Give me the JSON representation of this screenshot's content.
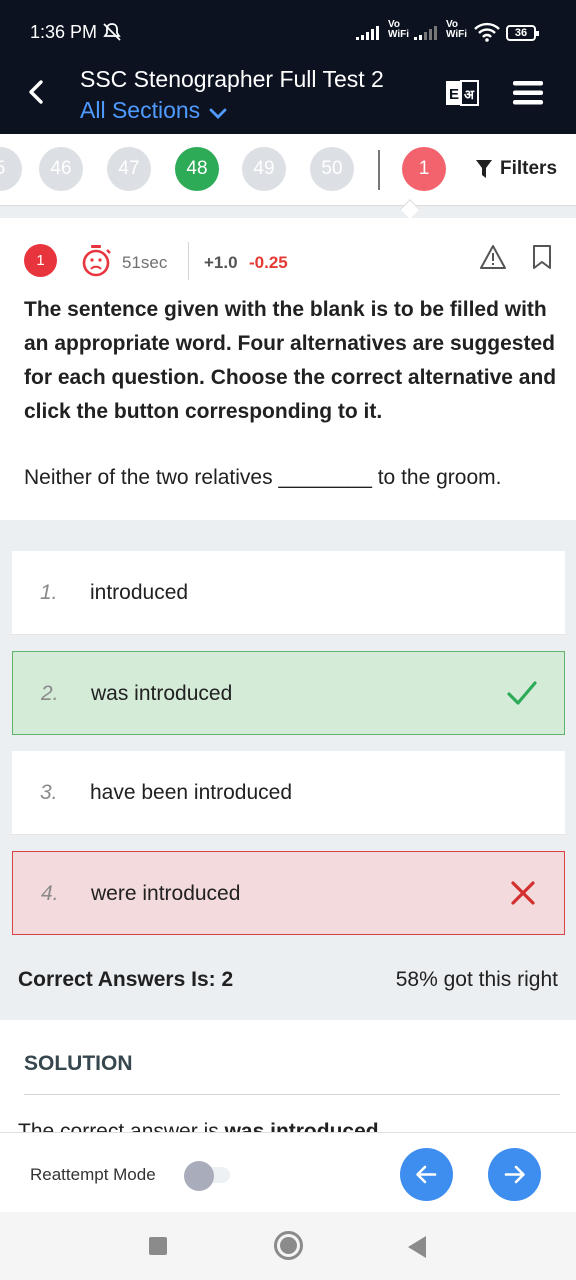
{
  "status_bar": {
    "time": "1:36 PM",
    "mute_icon": "bell-off-icon",
    "vo_wifi_label_1": "Vo\nWiFi",
    "vo_wifi_label_2": "Vo\nWiFi",
    "battery": "36"
  },
  "header": {
    "title": "SSC Stenographer Full Test 2",
    "sections_label": "All Sections",
    "back_icon": "chevron-left-icon",
    "language_icon": "language-toggle-icon",
    "menu_icon": "hamburger-menu-icon"
  },
  "question_nav": {
    "bubbles": [
      "5",
      "46",
      "47",
      "48",
      "49",
      "50"
    ],
    "current": "48",
    "flag_bubble": "1",
    "filters_label": "Filters"
  },
  "question": {
    "number": "1",
    "time_taken": "51sec",
    "positive_marks": "+1.0",
    "negative_marks": "-0.25",
    "instruction": "The sentence given with the blank is to be filled with an appropriate word. Four alternatives are suggested for each question. Choose the correct alternative and click the button corresponding to it.",
    "sentence": "Neither of the two relatives ________ to the groom."
  },
  "options": [
    {
      "num": "1.",
      "text": "introduced",
      "state": "neutral"
    },
    {
      "num": "2.",
      "text": "was introduced",
      "state": "correct"
    },
    {
      "num": "3.",
      "text": "have been introduced",
      "state": "neutral"
    },
    {
      "num": "4.",
      "text": "were introduced",
      "state": "wrong"
    }
  ],
  "result": {
    "correct_answer": "Correct Answers Is: 2",
    "stats": "58% got this right"
  },
  "solution": {
    "heading": "SOLUTION",
    "preview": "The correct answer is was introduced"
  },
  "bottom": {
    "reattempt_label": "Reattempt Mode",
    "reattempt_on": false
  },
  "colors": {
    "header_bg": "#0c1220",
    "accent_blue": "#4f9bff",
    "current_bubble": "#2eab57",
    "flag_bubble": "#f3636e",
    "correct_bg": "#d4ebd8",
    "wrong_bg": "#f3dadc"
  }
}
